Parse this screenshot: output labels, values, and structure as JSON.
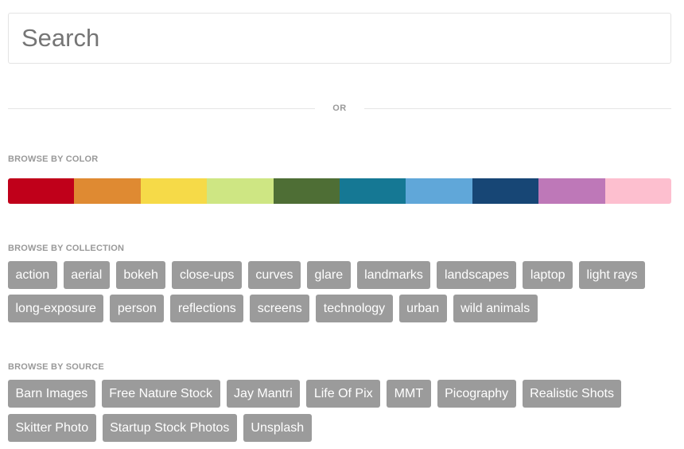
{
  "search": {
    "placeholder": "Search",
    "value": ""
  },
  "divider": {
    "text": "OR"
  },
  "color_section": {
    "label": "BROWSE BY COLOR",
    "colors": [
      "#c0001a",
      "#df8a32",
      "#f6da48",
      "#cee683",
      "#4e6e35",
      "#157894",
      "#60a7d9",
      "#174675",
      "#be78b8",
      "#fdbfcf"
    ]
  },
  "collection_section": {
    "label": "BROWSE BY COLLECTION",
    "tags": [
      "action",
      "aerial",
      "bokeh",
      "close-ups",
      "curves",
      "glare",
      "landmarks",
      "landscapes",
      "laptop",
      "light rays",
      "long-exposure",
      "person",
      "reflections",
      "screens",
      "technology",
      "urban",
      "wild animals"
    ]
  },
  "source_section": {
    "label": "BROWSE BY SOURCE",
    "tags": [
      "Barn Images",
      "Free Nature Stock",
      "Jay Mantri",
      "Life Of Pix",
      "MMT",
      "Picography",
      "Realistic Shots",
      "Skitter Photo",
      "Startup Stock Photos",
      "Unsplash"
    ]
  }
}
